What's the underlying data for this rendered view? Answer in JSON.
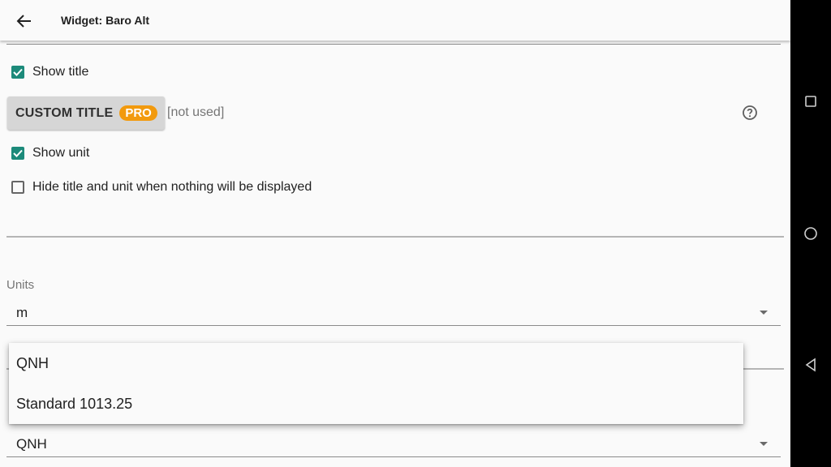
{
  "appbar": {
    "title": "Widget: Baro Alt",
    "back_icon": "arrow-left-icon"
  },
  "checkboxes": {
    "show_title": {
      "label": "Show title",
      "checked": true
    },
    "show_unit": {
      "label": "Show unit",
      "checked": true
    },
    "hide_title_unit": {
      "label": "Hide title and unit when nothing will be displayed",
      "checked": false
    }
  },
  "custom_title": {
    "label": "CUSTOM TITLE",
    "badge": "PRO",
    "value": "[not used]",
    "badge_color": "#f29a0e"
  },
  "units": {
    "label": "Units",
    "value": "m"
  },
  "pressure": {
    "value": "QNH"
  },
  "dropdown": {
    "options": [
      "QNH",
      "Standard 1013.25"
    ]
  },
  "colors": {
    "accent": "#1c8a7a",
    "background": "#fafafa"
  },
  "navbar": {
    "icons": [
      "square-icon",
      "circle-icon",
      "triangle-back-icon"
    ]
  }
}
